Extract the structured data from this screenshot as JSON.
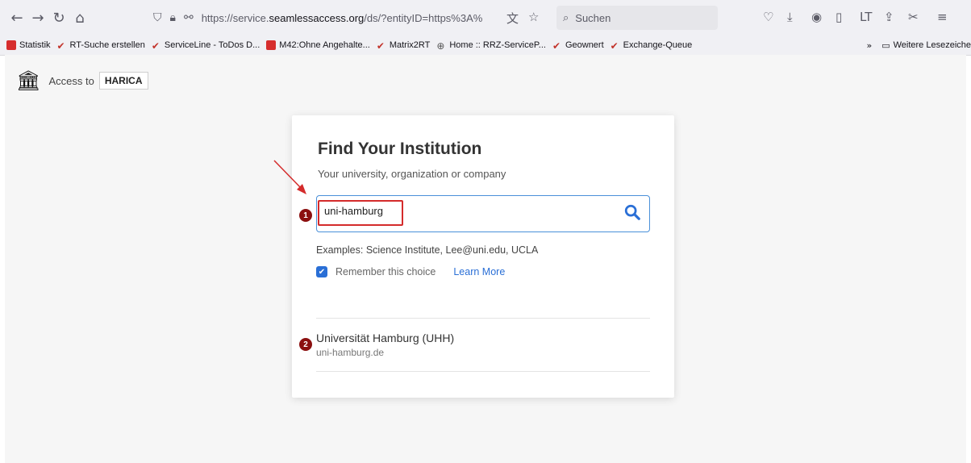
{
  "browser": {
    "url_prefix": "https://service.",
    "url_domain": "seamlessaccess.org",
    "url_rest": "/ds/?entityID=https%3A%",
    "search_placeholder": "Suchen"
  },
  "bookmarks": {
    "items": [
      {
        "label": "Statistik",
        "icon": "red-square"
      },
      {
        "label": "RT-Suche erstellen",
        "icon": "check"
      },
      {
        "label": "ServiceLine - ToDos D...",
        "icon": "check"
      },
      {
        "label": "M42:Ohne Angehalte...",
        "icon": "red-square"
      },
      {
        "label": "Matrix2RT",
        "icon": "check"
      },
      {
        "label": "Home :: RRZ-ServiceP...",
        "icon": "globe"
      },
      {
        "label": "Geownert",
        "icon": "check"
      },
      {
        "label": "Exchange-Queue",
        "icon": "check"
      }
    ],
    "more_label": "Weitere Lesezeiche"
  },
  "header": {
    "access_label": "Access to",
    "service_name": "HARICA"
  },
  "card": {
    "title": "Find Your Institution",
    "subtitle": "Your university, organization or company",
    "search_value": "uni-hamburg",
    "examples": "Examples: Science Institute, Lee@uni.edu, UCLA",
    "remember_label": "Remember this choice",
    "learn_more": "Learn More",
    "result": {
      "name": "Universität Hamburg (UHH)",
      "domain": "uni-hamburg.de"
    }
  },
  "annotations": {
    "step1": "1",
    "step2": "2"
  },
  "colors": {
    "accent": "#2a6fd6",
    "highlight": "#d42b2b",
    "badge": "#8b0f0f"
  }
}
